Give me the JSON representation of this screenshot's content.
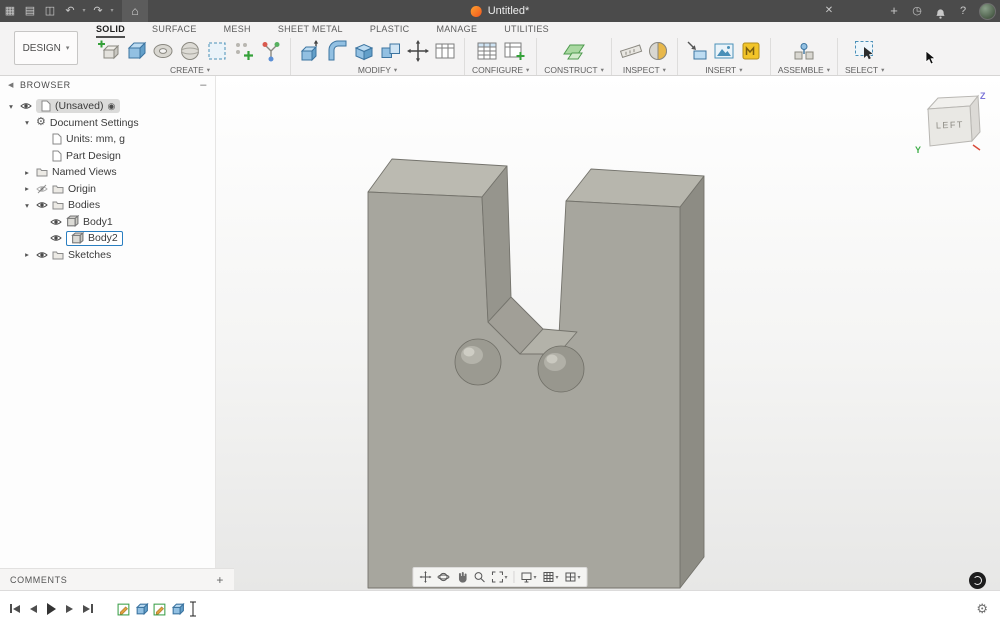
{
  "titlebar": {
    "title": "Untitled*"
  },
  "icons": {
    "caret": "▾",
    "minimize": "–",
    "collapse": "◀",
    "active_doc": "◉",
    "plus": "+",
    "close": "✕",
    "undo": "↶",
    "redo": "↷",
    "home": "⌂",
    "gear": "⚙",
    "apps": "▦",
    "file": "▤",
    "save": "◫",
    "clock": "◷",
    "help": "?"
  },
  "ribbon": {
    "design_label": "DESIGN",
    "tabs": [
      {
        "label": "SOLID"
      },
      {
        "label": "SURFACE"
      },
      {
        "label": "MESH"
      },
      {
        "label": "SHEET METAL"
      },
      {
        "label": "PLASTIC"
      },
      {
        "label": "MANAGE"
      },
      {
        "label": "UTILITIES"
      }
    ],
    "groups": [
      {
        "label": "CREATE"
      },
      {
        "label": "MODIFY"
      },
      {
        "label": "CONFIGURE"
      },
      {
        "label": "CONSTRUCT"
      },
      {
        "label": "INSPECT"
      },
      {
        "label": "INSERT"
      },
      {
        "label": "ASSEMBLE"
      },
      {
        "label": "SELECT"
      }
    ]
  },
  "browser": {
    "header": "BROWSER",
    "rows": [
      {
        "expander": "▾",
        "label": "(Unsaved)"
      },
      {
        "expander": "▾",
        "label": "Document Settings"
      },
      {
        "expander": "",
        "label": "Units: mm, g"
      },
      {
        "expander": "",
        "label": "Part Design"
      },
      {
        "expander": "▸",
        "label": "Named Views"
      },
      {
        "expander": "▸",
        "label": "Origin"
      },
      {
        "expander": "▾",
        "label": "Bodies"
      },
      {
        "expander": "",
        "label": "Body1"
      },
      {
        "expander": "",
        "label": "Body2"
      },
      {
        "expander": "▸",
        "label": "Sketches"
      }
    ],
    "comments": {
      "label": "COMMENTS",
      "add": "+"
    }
  },
  "viewcube": {
    "face": "LEFT",
    "axis_z": "Z",
    "axis_y": "Y"
  }
}
